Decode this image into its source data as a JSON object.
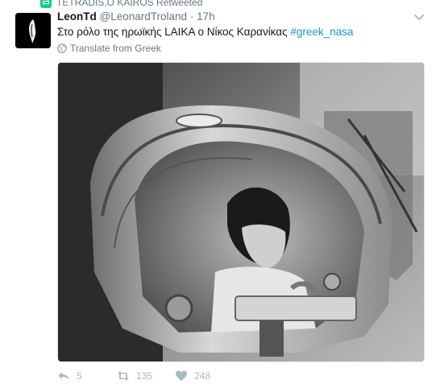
{
  "retweet_header": {
    "text": "TETRADIS,O KAIROS Retweeted"
  },
  "tweet": {
    "display_name": "LeonTd",
    "handle": "@LeonardTroland",
    "separator": "·",
    "time": "17h",
    "text": "Στο ρόλο της ηρωϊκής LAIKA ο Νίκος Καρανίκας ",
    "hashtag": "#greek_nasa",
    "translate_label": "Translate from Greek"
  },
  "actions": {
    "reply_count": "5",
    "retweet_count": "135",
    "like_count": "248"
  },
  "colors": {
    "link": "#1b95e0",
    "secondary_text": "#657786",
    "action_icon": "#aab8c2",
    "retweet_green": "#19cf86"
  },
  "icons": {
    "retweet_header": "retweet-icon",
    "caret": "chevron-down-icon",
    "translate": "globe-icon",
    "reply": "reply-icon",
    "retweet": "retweet-icon",
    "like": "heart-icon"
  }
}
